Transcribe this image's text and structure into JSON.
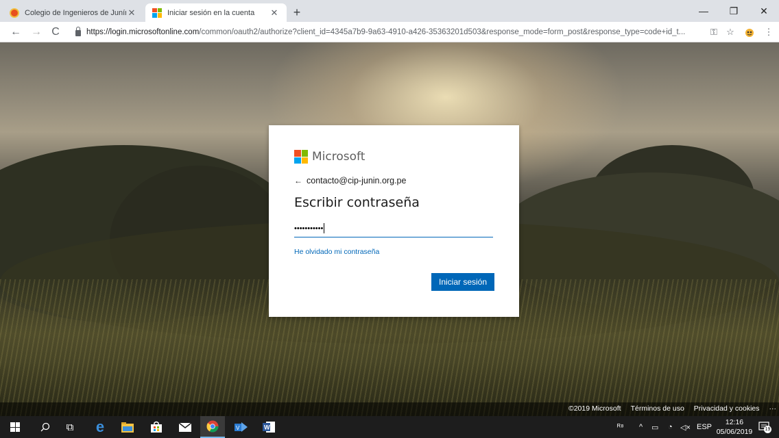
{
  "browser": {
    "tabs": [
      {
        "title": "Colegio de Ingenieros de Junín",
        "favicon": "cip-logo-icon"
      },
      {
        "title": "Iniciar sesión en la cuenta",
        "favicon": "microsoft-logo-icon"
      }
    ],
    "url_domain": "https://login.microsoftonline.com",
    "url_rest": "/common/oauth2/authorize?client_id=4345a7b9-9a63-4910-a426-35363201d503&response_mode=form_post&response_type=code+id_t..."
  },
  "signin": {
    "brand": "Microsoft",
    "identity_email": "contacto@cip-junin.org.pe",
    "title": "Escribir contraseña",
    "password_mask": "•••••••••••",
    "forgot_link": "He olvidado mi contraseña",
    "submit_label": "Iniciar sesión"
  },
  "footer": {
    "copyright": "©2019 Microsoft",
    "terms": "Términos de uso",
    "privacy": "Privacidad y cookies",
    "more": "···"
  },
  "taskbar": {
    "language": "ESP",
    "time": "12:16",
    "date": "05/06/2019",
    "notification_count": "19"
  },
  "colors": {
    "ms_red": "#f25022",
    "ms_green": "#7fba00",
    "ms_blue": "#00a4ef",
    "ms_yellow": "#ffb900",
    "accent": "#0067b8"
  }
}
